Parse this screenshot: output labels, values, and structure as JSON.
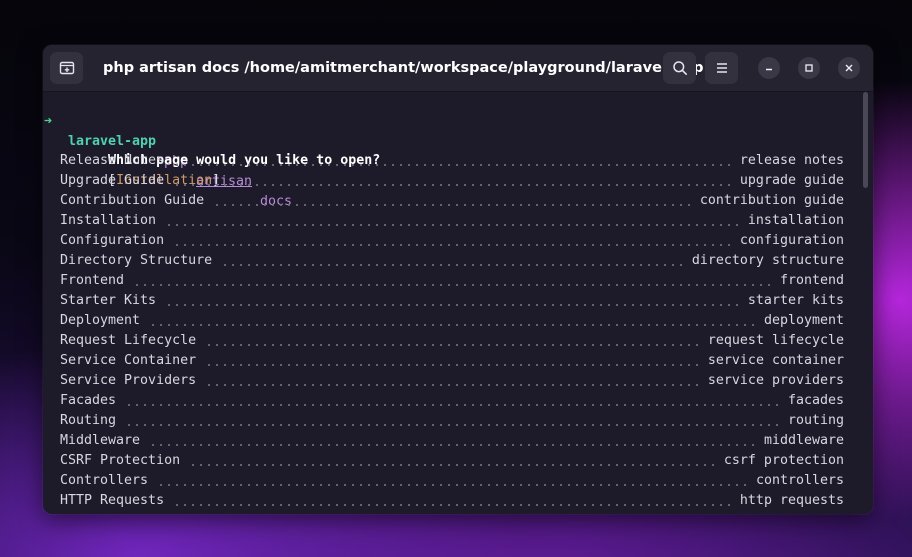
{
  "window": {
    "title": "php artisan docs /home/amitmerchant/workspace/playground/laravel-app"
  },
  "icons": {
    "new_tab": "new-tab-icon",
    "search": "search-icon",
    "menu": "hamburger-menu-icon",
    "minimize": "minimize-icon",
    "maximize": "maximize-icon",
    "close": "close-icon"
  },
  "colors": {
    "prompt_arrow": "#4fd18c",
    "prompt_dir": "#4fd1b0",
    "command": "#b98bdb",
    "default_choice": "#d09a6a",
    "terminal_bg": "#1d1b29"
  },
  "terminal": {
    "prompt": {
      "arrow": "➜",
      "dir": "laravel-app",
      "cmd": "php",
      "arg1": "artisan",
      "arg2": "docs"
    },
    "question": {
      "text": "Which page would you like to open?",
      "open_bracket": "[",
      "default": "Installation",
      "close_bracket": "]"
    },
    "options": [
      {
        "label": "Release Notes",
        "key": "release notes"
      },
      {
        "label": "Upgrade Guide",
        "key": "upgrade guide"
      },
      {
        "label": "Contribution Guide",
        "key": "contribution guide"
      },
      {
        "label": "Installation",
        "key": "installation"
      },
      {
        "label": "Configuration",
        "key": "configuration"
      },
      {
        "label": "Directory Structure",
        "key": "directory structure"
      },
      {
        "label": "Frontend",
        "key": "frontend"
      },
      {
        "label": "Starter Kits",
        "key": "starter kits"
      },
      {
        "label": "Deployment",
        "key": "deployment"
      },
      {
        "label": "Request Lifecycle",
        "key": "request lifecycle"
      },
      {
        "label": "Service Container",
        "key": "service container"
      },
      {
        "label": "Service Providers",
        "key": "service providers"
      },
      {
        "label": "Facades",
        "key": "facades"
      },
      {
        "label": "Routing",
        "key": "routing"
      },
      {
        "label": "Middleware",
        "key": "middleware"
      },
      {
        "label": "CSRF Protection",
        "key": "csrf protection"
      },
      {
        "label": "Controllers",
        "key": "controllers"
      },
      {
        "label": "HTTP Requests",
        "key": "http requests"
      }
    ]
  }
}
